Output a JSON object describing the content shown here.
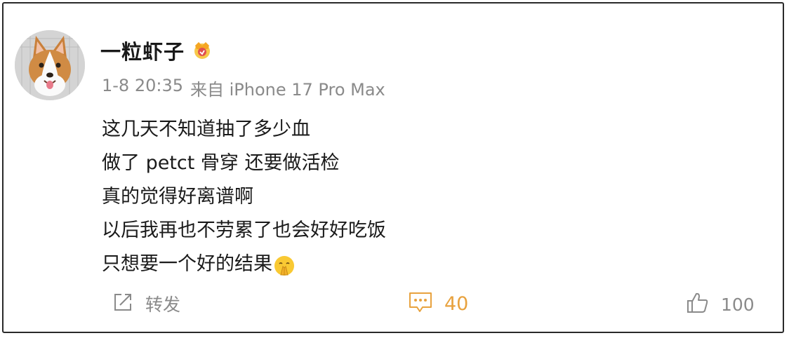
{
  "post": {
    "author": "一粒虾子",
    "timestamp": "1-8 20:35",
    "source": "来自 iPhone 17 Pro Max",
    "lines": [
      "这几天不知道抽了多少血",
      "做了 petct 骨穿 还要做活检",
      "真的觉得好离谱啊",
      "以后我再也不劳累了也会好好吃饭",
      "只想要一个好的结果"
    ],
    "end_emoji": "pray-emoji-icon"
  },
  "actions": {
    "share_label": "转发",
    "comment_count": "40",
    "like_count": "100"
  },
  "icons": {
    "vip": "vip-badge-icon",
    "share": "share-icon",
    "comment": "comment-icon",
    "like": "thumbs-up-icon"
  },
  "colors": {
    "text": "#1a1a1a",
    "meta": "#8a8a8a",
    "comment_accent": "#e8a23e",
    "border": "#2a2a2a"
  }
}
